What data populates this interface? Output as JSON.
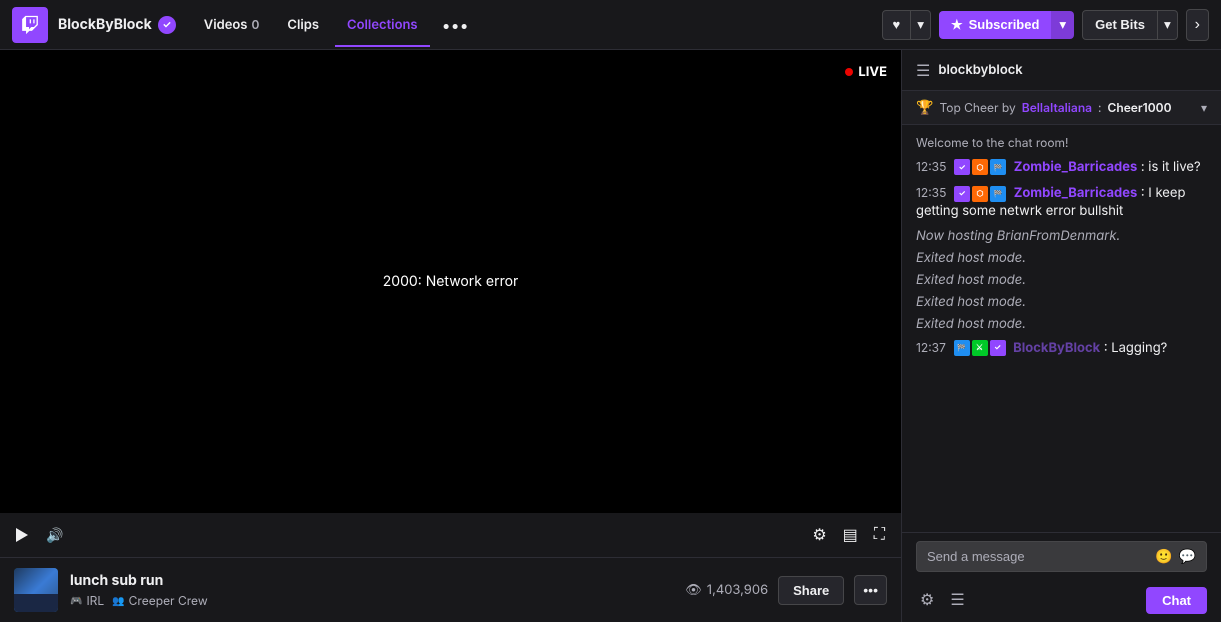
{
  "nav": {
    "channel": "BlockByBlock",
    "verified": true,
    "links": [
      {
        "label": "Videos",
        "badge": "0",
        "active": false
      },
      {
        "label": "Clips",
        "badge": "",
        "active": false
      },
      {
        "label": "Collections",
        "badge": "",
        "active": true
      }
    ],
    "more_label": "•••",
    "heart_label": "♥",
    "subscribed_label": "Subscribed",
    "get_bits_label": "Get Bits"
  },
  "chat": {
    "header_channel": "blockbyblock",
    "top_cheer_label": "Top Cheer by",
    "top_cheer_user": "BellaItaliana",
    "top_cheer_amount": "Cheer1000",
    "welcome_msg": "Welcome to the chat room!",
    "messages": [
      {
        "time": "12:35",
        "username": "Zombie_Barricades",
        "username_color": "#9147ff",
        "content": " is it live?",
        "badges": [
          "sub",
          "bits",
          "flag"
        ]
      },
      {
        "time": "12:35",
        "username": "Zombie_Barricades",
        "username_color": "#9147ff",
        "content": " I keep getting some netwrk error bullshit",
        "badges": [
          "sub",
          "bits",
          "flag"
        ]
      },
      {
        "time": "",
        "username": "",
        "content": "Now hosting BrianFromDenmark.",
        "system": true
      },
      {
        "time": "",
        "username": "",
        "content": "Exited host mode.",
        "system": true
      },
      {
        "time": "",
        "username": "",
        "content": "Exited host mode.",
        "system": true
      },
      {
        "time": "",
        "username": "",
        "content": "Exited host mode.",
        "system": true
      },
      {
        "time": "",
        "username": "",
        "content": "Exited host mode.",
        "system": true
      },
      {
        "time": "12:37",
        "username": "BlockByBlock",
        "username_color": "#6441a5",
        "content": " Lagging?",
        "badges": [
          "flag2",
          "mod2",
          "check"
        ]
      }
    ],
    "input_placeholder": "Send a message",
    "chat_button_label": "Chat"
  },
  "video": {
    "live_label": "LIVE",
    "error_text": "2000: Network error"
  },
  "stream": {
    "title": "lunch sub run",
    "tag_irl": "IRL",
    "tag_crew": "Creeper Crew",
    "view_count": "1,403,906",
    "share_label": "Share"
  }
}
